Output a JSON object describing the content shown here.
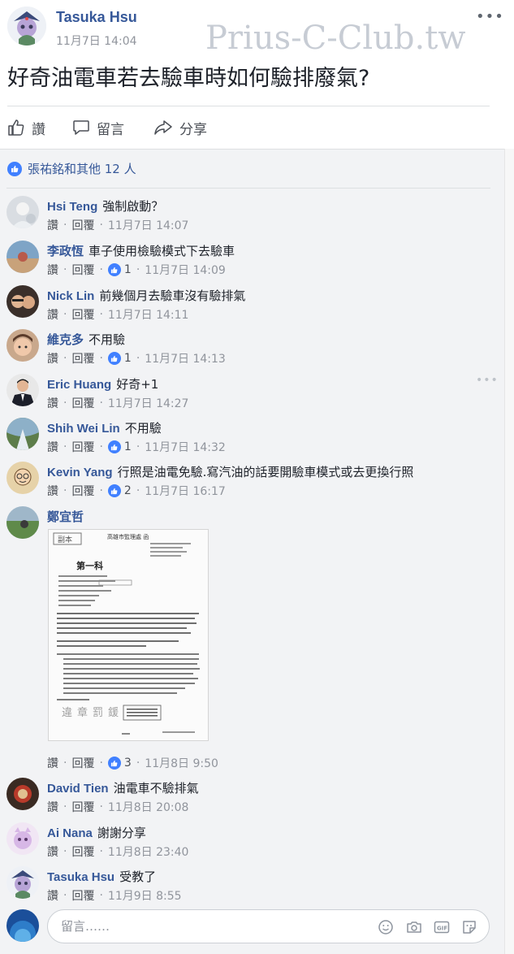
{
  "post": {
    "author": "Tasuka Hsu",
    "timestamp": "11月7日 14:04",
    "watermark": "Prius-C-Club.tw",
    "text": "好奇油電車若去驗車時如何驗排廢氣?"
  },
  "actions": {
    "like": "讚",
    "comment": "留言",
    "share": "分享"
  },
  "likes_summary": "張祐銘和其他 12 人",
  "comment_actions": {
    "like": "讚",
    "reply": "回覆",
    "separator": "·"
  },
  "comments": [
    {
      "name": "Hsi Teng",
      "text": "強制啟動？",
      "likes": "",
      "time": "11月7日 14:07"
    },
    {
      "name": "李政恆",
      "text": "車子使用檢驗模式下去驗車",
      "likes": "1",
      "time": "11月7日 14:09"
    },
    {
      "name": "Nick Lin",
      "text": "前幾個月去驗車沒有驗排氣",
      "likes": "",
      "time": "11月7日 14:11"
    },
    {
      "name": "維克多",
      "text": "不用驗",
      "likes": "1",
      "time": "11月7日 14:13"
    },
    {
      "name": "Eric Huang",
      "text": "好奇+1",
      "likes": "",
      "time": "11月7日 14:27"
    },
    {
      "name": "Shih Wei Lin",
      "text": "不用驗",
      "likes": "1",
      "time": "11月7日 14:32"
    },
    {
      "name": "Kevin Yang",
      "text": "行照是油電免驗.寫汽油的話要開驗車模式或去更換行照",
      "likes": "2",
      "time": "11月7日 16:17"
    },
    {
      "name": "鄭宜哲",
      "text": "",
      "likes": "3",
      "time": "11月8日 9:50"
    },
    {
      "name": "David Tien",
      "text": "油電車不驗排氣",
      "likes": "",
      "time": "11月8日 20:08"
    },
    {
      "name": "Ai Nana",
      "text": "謝謝分享",
      "likes": "",
      "time": "11月8日 23:40"
    },
    {
      "name": "Tasuka Hsu",
      "text": "受教了",
      "likes": "",
      "time": "11月9日 8:55"
    }
  ],
  "attachment": {
    "stamp": "副本",
    "heading": "高雄市監理處 函",
    "doc_title": "第一科",
    "seal": "違章罰鍰"
  },
  "composer": {
    "placeholder": "留言……"
  },
  "colors": {
    "link": "#365899",
    "meta": "#90949c",
    "like_blue": "#4080ff",
    "comments_bg": "#f2f3f5"
  }
}
